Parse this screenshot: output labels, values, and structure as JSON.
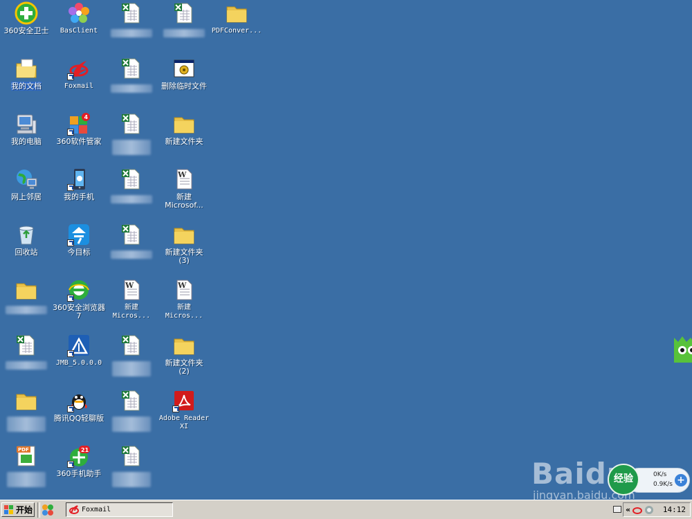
{
  "desktop": {
    "background": "#3a6ea5",
    "icons": {
      "c1": [
        {
          "name": "360安全卫士",
          "icon": "360-guard-icon"
        },
        {
          "name": "我的文档",
          "icon": "my-documents-icon"
        },
        {
          "name": "我的电脑",
          "icon": "my-computer-icon"
        },
        {
          "name": "网上邻居",
          "icon": "network-icon"
        },
        {
          "name": "回收站",
          "icon": "recycle-bin-icon"
        },
        {
          "name": "",
          "icon": "folder-icon"
        },
        {
          "name": "",
          "icon": "excel-file-icon"
        },
        {
          "name": "",
          "icon": "folder-icon"
        },
        {
          "name": "",
          "icon": "pdf-file-icon"
        }
      ],
      "c2": [
        {
          "name": "BasClient",
          "icon": "basclient-flower-icon"
        },
        {
          "name": "Foxmail",
          "icon": "foxmail-icon"
        },
        {
          "name": "360软件管家",
          "icon": "360-software-manager-icon"
        },
        {
          "name": "我的手机",
          "icon": "my-phone-icon"
        },
        {
          "name": "今目标",
          "icon": "jinmubiao-icon"
        },
        {
          "name": "360安全浏览器7",
          "icon": "360-browser-icon"
        },
        {
          "name": "JMB_5.0.0.0",
          "icon": "jmb-icon"
        },
        {
          "name": "腾讯QQ轻聊版",
          "icon": "qq-icon"
        },
        {
          "name": "360手机助手",
          "icon": "360-phone-assistant-icon"
        }
      ],
      "c3": [
        {
          "name": "",
          "icon": "excel-file-icon"
        },
        {
          "name": "",
          "icon": "excel-file-icon"
        },
        {
          "name": "",
          "icon": "excel-file-icon"
        },
        {
          "name": "",
          "icon": "excel-file-icon"
        },
        {
          "name": "",
          "icon": "excel-file-icon"
        },
        {
          "name": "新建\nMicros...",
          "icon": "word-file-icon"
        },
        {
          "name": "",
          "icon": "excel-file-icon"
        },
        {
          "name": "",
          "icon": "excel-file-icon"
        },
        {
          "name": "",
          "icon": "excel-file-icon"
        }
      ],
      "c4": [
        {
          "name": "",
          "icon": "excel-file-icon"
        },
        {
          "name": "删除临时文件",
          "icon": "batch-file-icon"
        },
        {
          "name": "新建文件夹",
          "icon": "folder-icon"
        },
        {
          "name": "新建\nMicrosof...",
          "icon": "word-file-icon"
        },
        {
          "name": "新建文件夹\n(3)",
          "icon": "folder-icon"
        },
        {
          "name": "新建\nMicros...",
          "icon": "word-file-icon"
        },
        {
          "name": "新建文件夹\n(2)",
          "icon": "folder-icon"
        },
        {
          "name": "Adobe Reader\nXI",
          "icon": "adobe-reader-icon"
        }
      ],
      "c5": [
        {
          "name": "PDFConver...",
          "icon": "folder-icon"
        }
      ]
    }
  },
  "taskbar": {
    "start_label": "开始",
    "task_label": "Foxmail",
    "clock": "14:12",
    "tray_chevron": "«"
  },
  "speed_widget": {
    "down": "0K/s",
    "up": "0.9K/s",
    "plus": "+"
  },
  "watermark": {
    "brand": "Baidu",
    "url": "jingyan.baidu.com",
    "badge": "经验"
  },
  "colors": {
    "excel_green": "#1f7a3a",
    "folder_yellow": "#f4d35e",
    "taskbar_gray": "#d4d0c8"
  }
}
